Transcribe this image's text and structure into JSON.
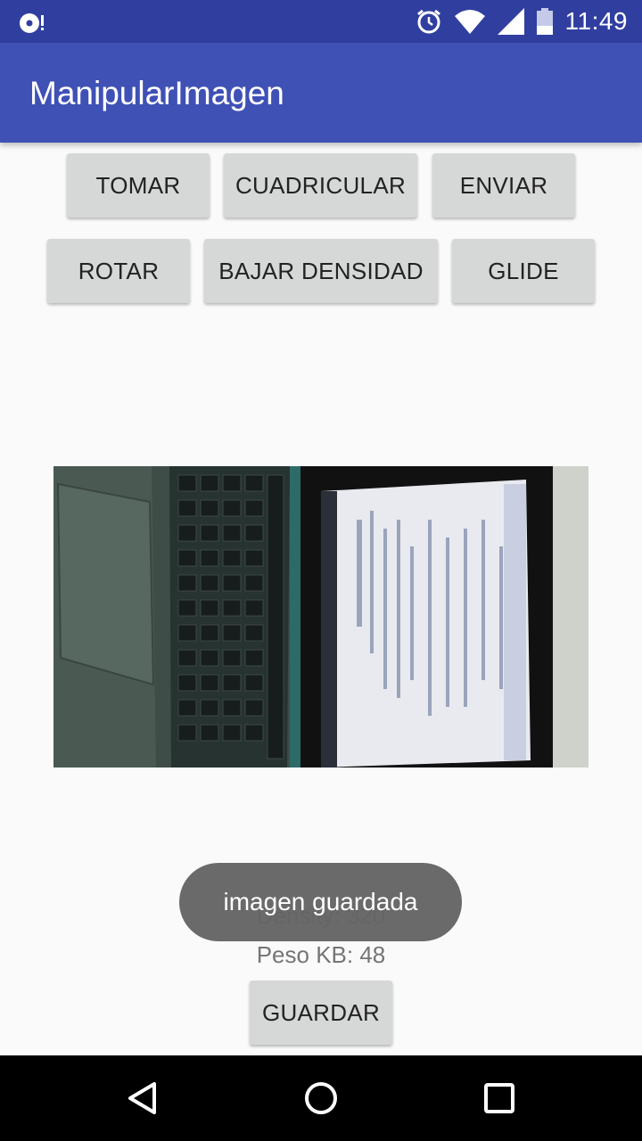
{
  "status_bar": {
    "time": "11:49",
    "left_icon": "notification-icon",
    "icons": [
      "alarm-icon",
      "wifi-icon",
      "cell-signal-icon",
      "battery-icon"
    ]
  },
  "app_bar": {
    "title": "ManipularImagen",
    "color": "#3f51b5",
    "status_color": "#303f9f"
  },
  "buttons": {
    "tomar": "TOMAR",
    "cuadricular": "CUADRICULAR",
    "enviar": "ENVIAR",
    "rotar": "ROTAR",
    "bajar_densidad": "BAJAR DENSIDAD",
    "glide": "GLIDE",
    "guardar": "GUARDAR"
  },
  "image": {
    "content": "photo of laptop screen"
  },
  "info": {
    "density": "Density: 320",
    "peso": "Peso KB: 48"
  },
  "toast": {
    "message": "imagen guardada"
  },
  "nav_bar": {
    "icons": [
      "back-icon",
      "home-icon",
      "recents-icon"
    ]
  }
}
